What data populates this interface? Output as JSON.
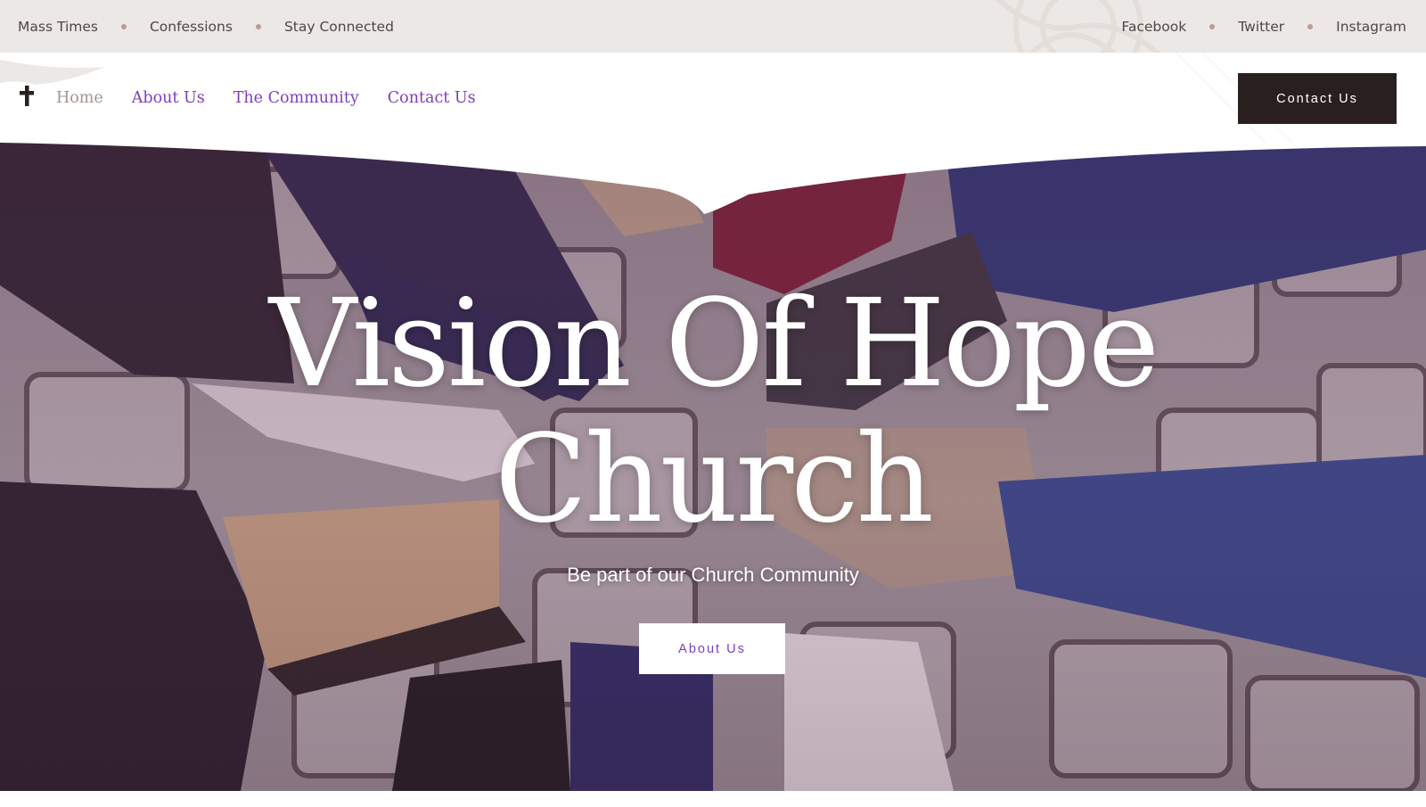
{
  "topbar": {
    "left_links": [
      "Mass Times",
      "Confessions",
      "Stay Connected"
    ],
    "right_links": [
      "Facebook",
      "Twitter",
      "Instagram"
    ]
  },
  "nav": {
    "logo_icon": "cross-icon",
    "links": [
      "Home",
      "About Us",
      "The Community",
      "Contact Us"
    ],
    "active": "Home",
    "cta_label": "Contact Us"
  },
  "hero": {
    "title_line1": "Vision Of Hope",
    "title_line2": "Church",
    "subtitle": "Be part of our Church Community",
    "button_label": "About Us",
    "background": "photo of a circle of shoes on cobblestones"
  },
  "colors": {
    "accent_purple": "#7d3fb6",
    "dark_button": "#2a1f1f",
    "topbar_bg": "#ece8e6",
    "dot": "#c09a8e"
  }
}
